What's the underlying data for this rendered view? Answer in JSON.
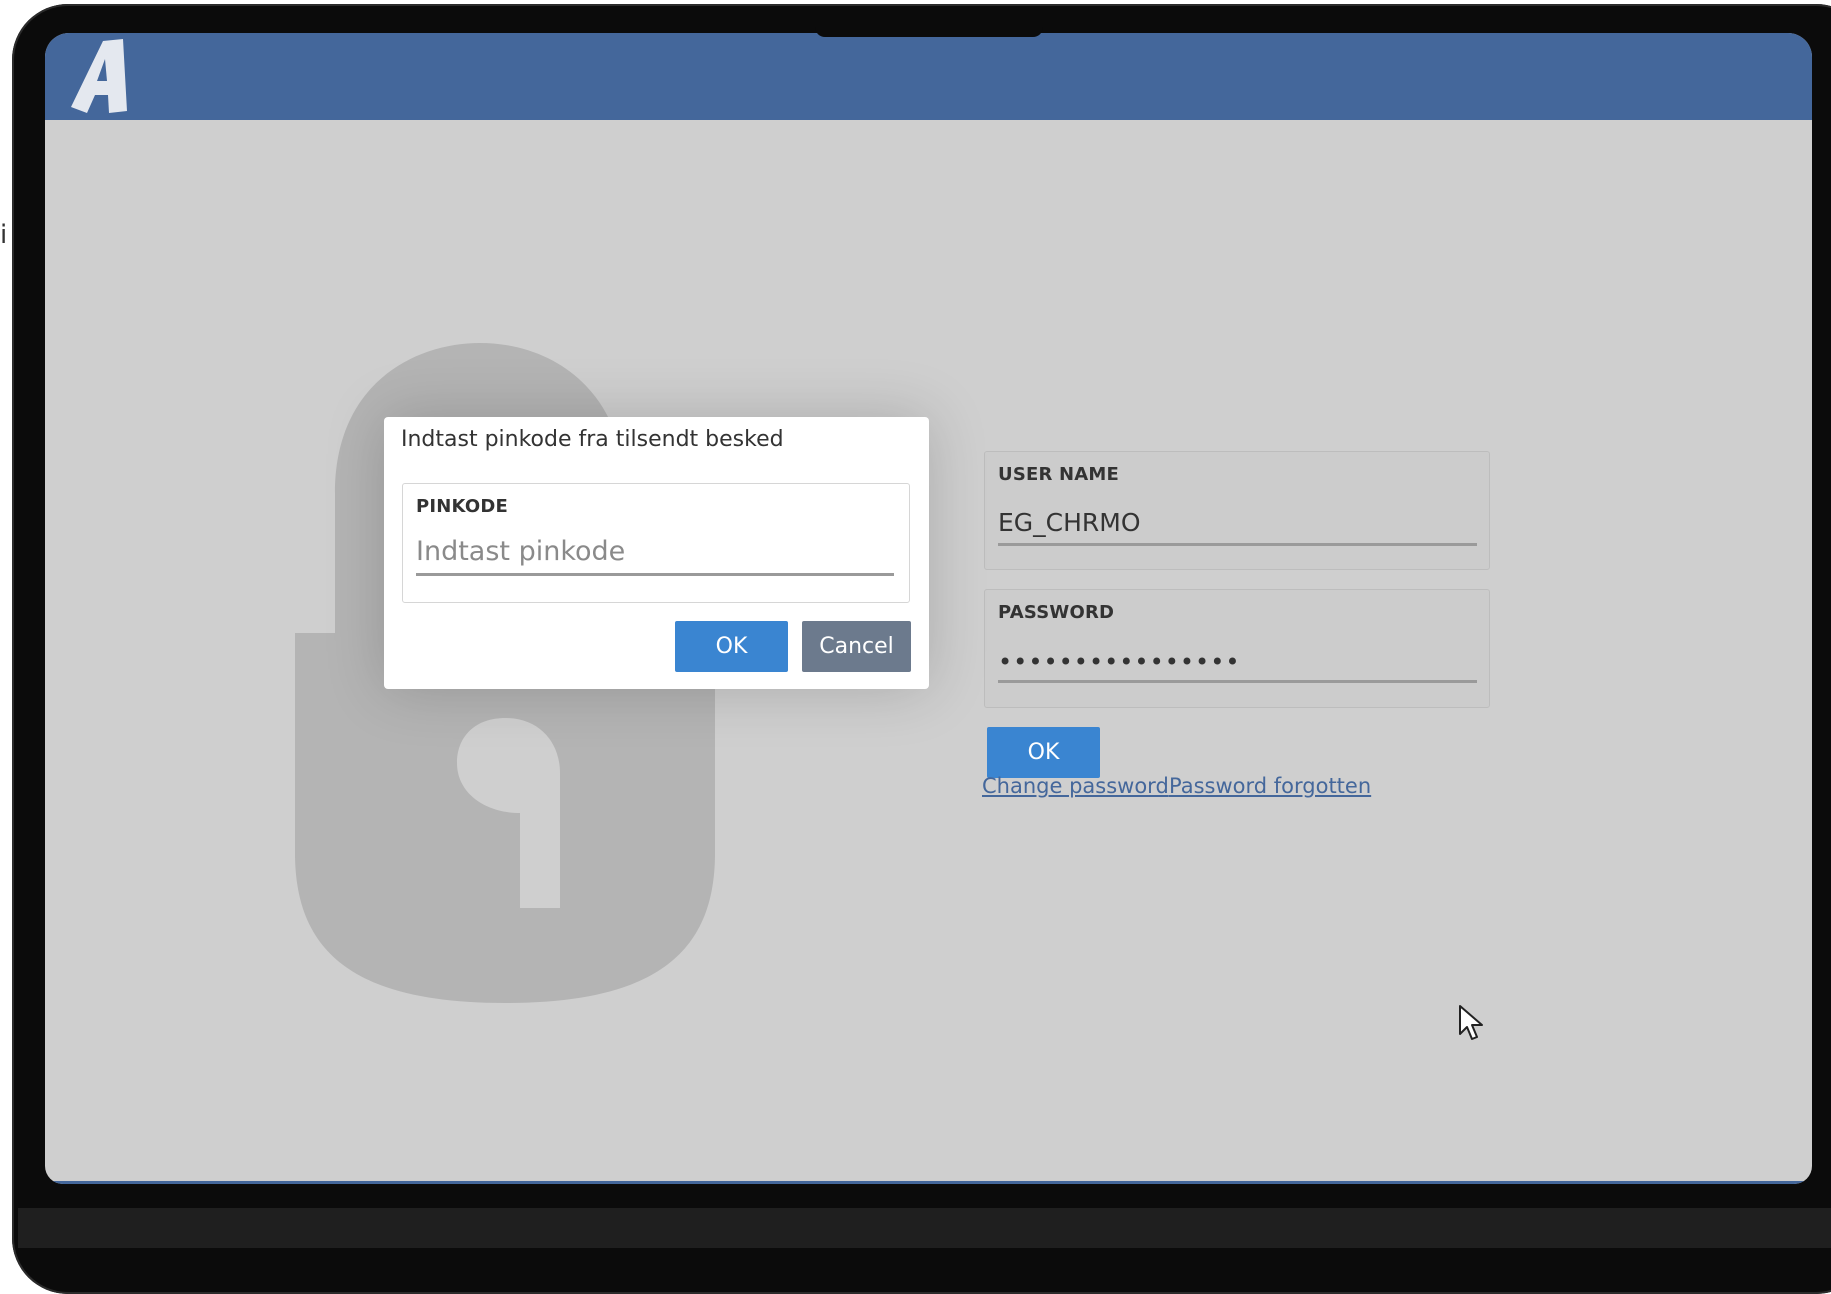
{
  "stray_text": "i",
  "login": {
    "username_label": "USER NAME",
    "username_value": "EG_CHRMO",
    "password_label": "PASSWORD",
    "password_value": "••••••••••••••••",
    "ok_label": "OK",
    "change_password_link": "Change password",
    "password_forgotten_link": "Password forgotten"
  },
  "pin_dialog": {
    "title": "Indtast pinkode fra tilsendt besked",
    "field_label": "PINKODE",
    "field_placeholder": "Indtast pinkode",
    "field_value": "",
    "ok_label": "OK",
    "cancel_label": "Cancel"
  },
  "colors": {
    "header": "#44679b",
    "primary_button": "#3a85d1",
    "secondary_button": "#6c7a8d",
    "link": "#44679b",
    "background": "#cfcfcf"
  },
  "icons": [
    "app-logo-icon",
    "padlock-background-icon",
    "mouse-pointer-icon"
  ]
}
